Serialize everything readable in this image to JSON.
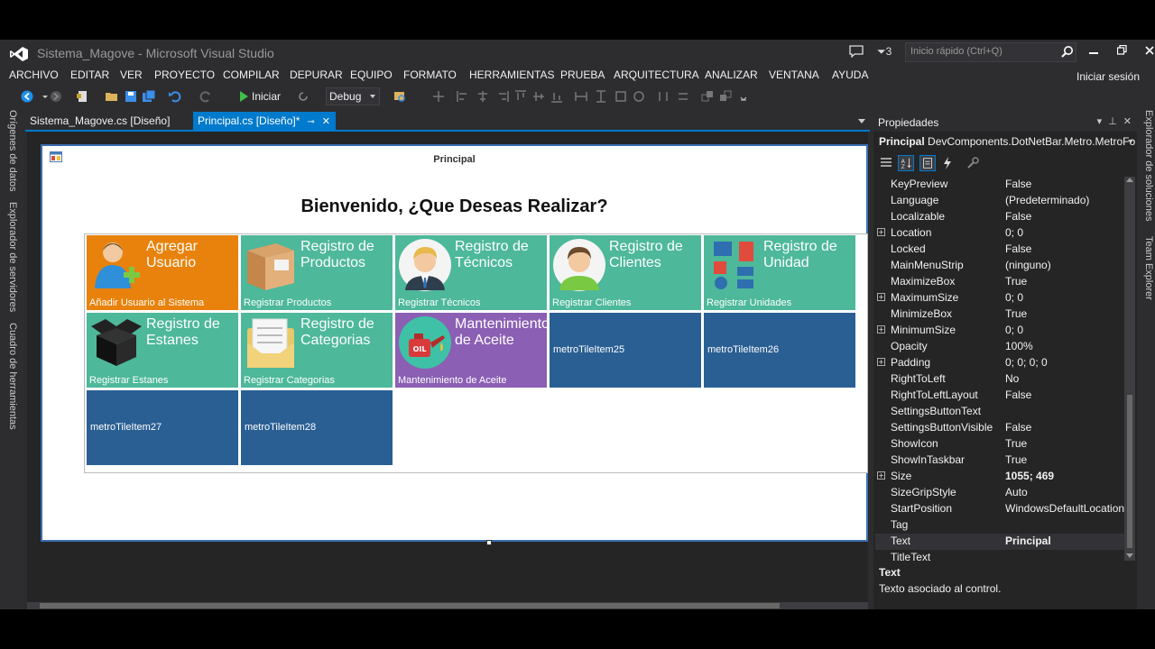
{
  "window": {
    "title": "Sistema_Magove - Microsoft Visual Studio",
    "notification_count": "3",
    "quick_launch_placeholder": "Inicio rápido (Ctrl+Q)",
    "sign_in": "Iniciar sesión"
  },
  "menu": [
    "ARCHIVO",
    "EDITAR",
    "VER",
    "PROYECTO",
    "COMPILAR",
    "DEPURAR",
    "EQUIPO",
    "FORMATO",
    "HERRAMIENTAS",
    "PRUEBA",
    "ARQUITECTURA",
    "ANALIZAR",
    "VENTANA",
    "AYUDA"
  ],
  "toolbar": {
    "start_label": "Iniciar",
    "config_value": "Debug"
  },
  "left_side_tabs": [
    "Orígenes de datos",
    "Explorador de servidores",
    "Cuadro de herramientas"
  ],
  "right_side_tabs": [
    "Explorador de soluciones",
    "Team Explorer"
  ],
  "doc_tabs": [
    {
      "label": "Sistema_Magove.cs [Diseño]",
      "active": false
    },
    {
      "label": "Principal.cs [Diseño]*",
      "active": true
    }
  ],
  "form": {
    "caption": "Principal",
    "heading": "Bienvenido, ¿Que Deseas Realizar?"
  },
  "tiles": [
    {
      "title": "Agregar Usuario",
      "footer": "Añadir Usuario al Sistema",
      "color": "#e8820c",
      "icon": "user-add-icon"
    },
    {
      "title": "Registro de Productos",
      "footer": "Registrar Productos",
      "color": "#4db89a",
      "icon": "box-icon"
    },
    {
      "title": "Registro de Técnicos",
      "footer": "Registrar Técnicos",
      "color": "#4db89a",
      "icon": "technician-avatar-icon"
    },
    {
      "title": "Registro de Clientes",
      "footer": "Registrar Clientes",
      "color": "#4db89a",
      "icon": "client-avatar-icon"
    },
    {
      "title": "Registro de Unidad",
      "footer": "Registrar Unidades",
      "color": "#4db89a",
      "icon": "units-icon"
    },
    {
      "title": "Registro de Estanes",
      "footer": "Registrar Estanes",
      "color": "#4db89a",
      "icon": "open-box-icon"
    },
    {
      "title": "Registro de Categorias",
      "footer": "Registrar Categorias",
      "color": "#4db89a",
      "icon": "folder-icon"
    },
    {
      "title": "Mantenimiento de Aceite",
      "footer": "Mantenimiento de Aceite",
      "color": "#8a5fb4",
      "icon": "oil-can-icon"
    },
    {
      "title": "",
      "footer": "metroTileItem25",
      "color": "#2a5f94",
      "icon": ""
    },
    {
      "title": "",
      "footer": "metroTileItem26",
      "color": "#2a5f94",
      "icon": ""
    },
    {
      "title": "",
      "footer": "metroTileItem27",
      "color": "#2a5f94",
      "icon": ""
    },
    {
      "title": "",
      "footer": "metroTileItem28",
      "color": "#2a5f94",
      "icon": ""
    }
  ],
  "properties": {
    "header": "Propiedades",
    "object_name": "Principal",
    "object_type": "DevComponents.DotNetBar.Metro.MetroFor",
    "rows": [
      {
        "name": "KeyPreview",
        "value": "False",
        "expandable": false,
        "bold": false
      },
      {
        "name": "Language",
        "value": "(Predeterminado)",
        "expandable": false,
        "bold": false
      },
      {
        "name": "Localizable",
        "value": "False",
        "expandable": false,
        "bold": false
      },
      {
        "name": "Location",
        "value": "0; 0",
        "expandable": true,
        "bold": false
      },
      {
        "name": "Locked",
        "value": "False",
        "expandable": false,
        "bold": false
      },
      {
        "name": "MainMenuStrip",
        "value": "(ninguno)",
        "expandable": false,
        "bold": false
      },
      {
        "name": "MaximizeBox",
        "value": "True",
        "expandable": false,
        "bold": false
      },
      {
        "name": "MaximumSize",
        "value": "0; 0",
        "expandable": true,
        "bold": false
      },
      {
        "name": "MinimizeBox",
        "value": "True",
        "expandable": false,
        "bold": false
      },
      {
        "name": "MinimumSize",
        "value": "0; 0",
        "expandable": true,
        "bold": false
      },
      {
        "name": "Opacity",
        "value": "100%",
        "expandable": false,
        "bold": false
      },
      {
        "name": "Padding",
        "value": "0; 0; 0; 0",
        "expandable": true,
        "bold": false
      },
      {
        "name": "RightToLeft",
        "value": "No",
        "expandable": false,
        "bold": false
      },
      {
        "name": "RightToLeftLayout",
        "value": "False",
        "expandable": false,
        "bold": false
      },
      {
        "name": "SettingsButtonText",
        "value": "",
        "expandable": false,
        "bold": false
      },
      {
        "name": "SettingsButtonVisible",
        "value": "False",
        "expandable": false,
        "bold": false
      },
      {
        "name": "ShowIcon",
        "value": "True",
        "expandable": false,
        "bold": false
      },
      {
        "name": "ShowInTaskbar",
        "value": "True",
        "expandable": false,
        "bold": false
      },
      {
        "name": "Size",
        "value": "1055; 469",
        "expandable": true,
        "bold": true
      },
      {
        "name": "SizeGripStyle",
        "value": "Auto",
        "expandable": false,
        "bold": false
      },
      {
        "name": "StartPosition",
        "value": "WindowsDefaultLocation",
        "expandable": false,
        "bold": false
      },
      {
        "name": "Tag",
        "value": "",
        "expandable": false,
        "bold": false
      },
      {
        "name": "Text",
        "value": "Principal",
        "expandable": false,
        "bold": true
      },
      {
        "name": "TitleText",
        "value": "",
        "expandable": false,
        "bold": false
      }
    ],
    "description_title": "Text",
    "description_text": "Texto asociado al control."
  },
  "colors": {
    "accent": "#007acc",
    "ide_background": "#2d2d30",
    "tile_orange": "#e8820c",
    "tile_teal": "#4db89a",
    "tile_purple": "#8a5fb4",
    "tile_blue": "#2a5f94"
  }
}
